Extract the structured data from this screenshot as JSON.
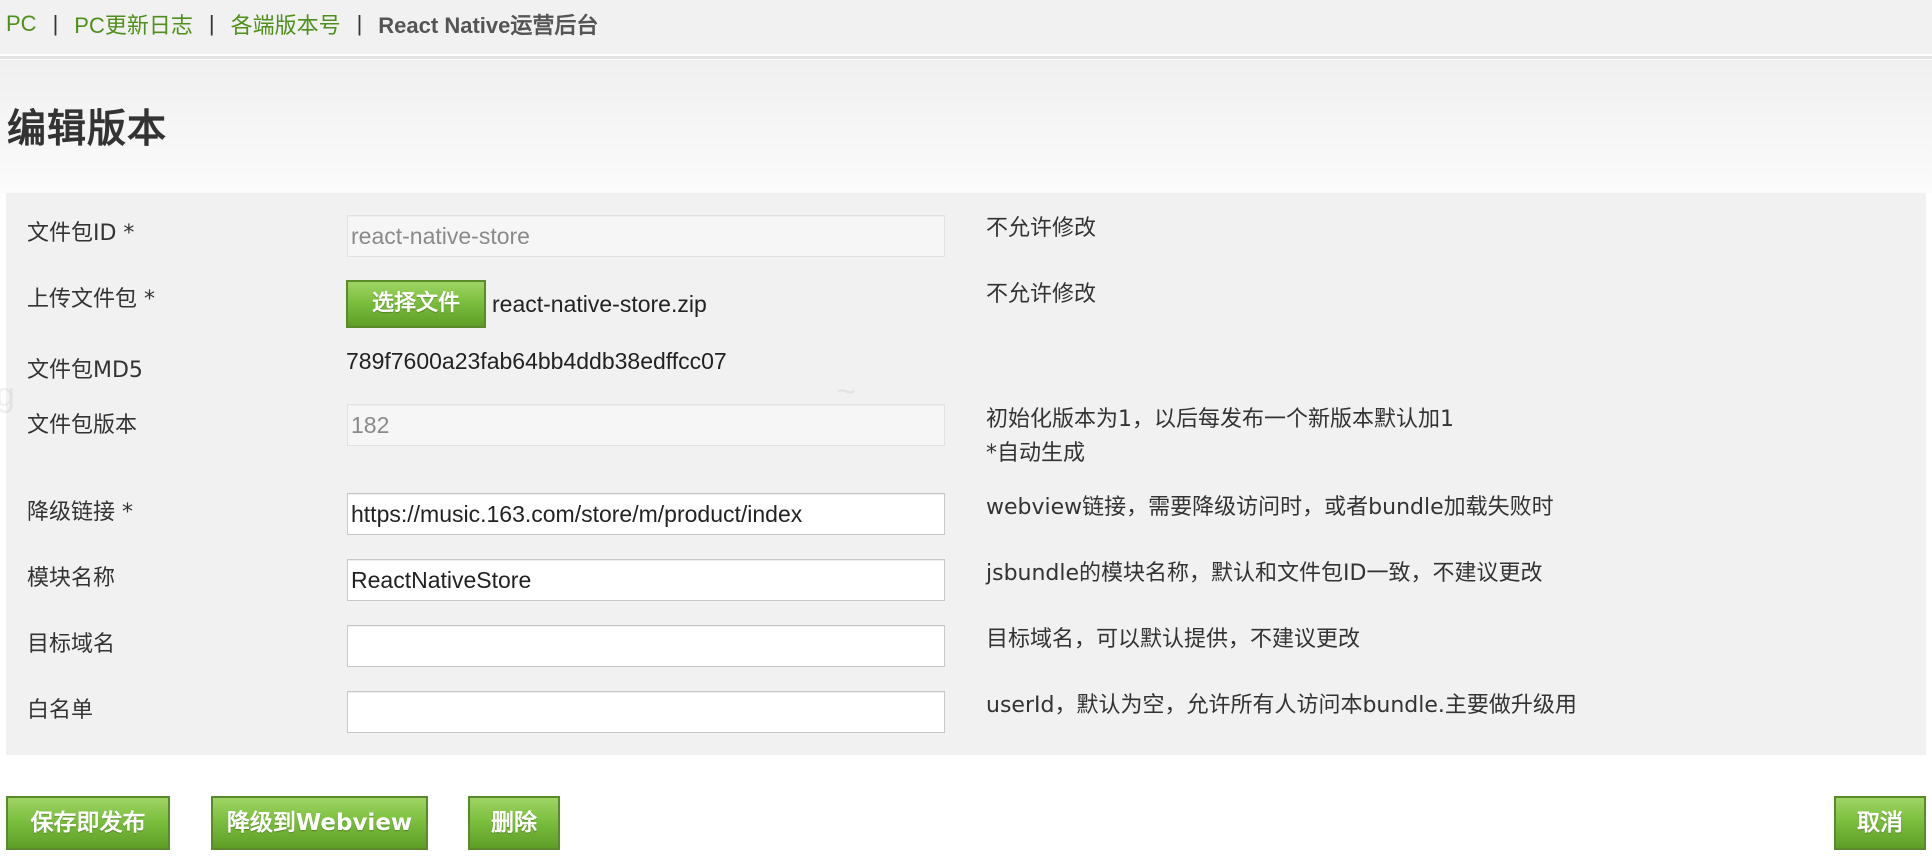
{
  "breadcrumb": {
    "links": [
      "PC",
      "PC更新日志",
      "各端版本号"
    ],
    "separator": "|",
    "current": "React Native运营后台"
  },
  "page": {
    "title": "编辑版本"
  },
  "form": {
    "package_id": {
      "label": "文件包ID *",
      "value": "react-native-store",
      "readonly": true,
      "note": "不允许修改"
    },
    "upload": {
      "label": "上传文件包 *",
      "button_label": "选择文件",
      "filename": "react-native-store.zip",
      "note": "不允许修改"
    },
    "md5": {
      "label": "文件包MD5",
      "value": "789f7600a23fab64bb4ddb38edffcc07"
    },
    "version": {
      "label": "文件包版本",
      "value": "182",
      "readonly": true,
      "note_line1": "初始化版本为1，以后每发布一个新版本默认加1",
      "note_line2": "*自动生成"
    },
    "fallback_url": {
      "label": "降级链接 *",
      "value": "https://music.163.com/store/m/product/index",
      "note": "webview链接，需要降级访问时，或者bundle加载失败时"
    },
    "module_name": {
      "label": "模块名称",
      "value": "ReactNativeStore",
      "note": "jsbundle的模块名称，默认和文件包ID一致，不建议更改"
    },
    "target_domain": {
      "label": "目标域名",
      "value": "",
      "note": "目标域名，可以默认提供，不建议更改"
    },
    "whitelist": {
      "label": "白名单",
      "value": "",
      "note": "userId，默认为空，允许所有人访问本bundle.主要做升级用"
    }
  },
  "actions": {
    "save_publish": "保存即发布",
    "downgrade_webview": "降级到Webview",
    "delete": "删除",
    "cancel": "取消"
  },
  "colors": {
    "link_green": "#4f8f1c",
    "button_green": "#7cbf3e",
    "panel_bg": "#f1f1f1"
  }
}
